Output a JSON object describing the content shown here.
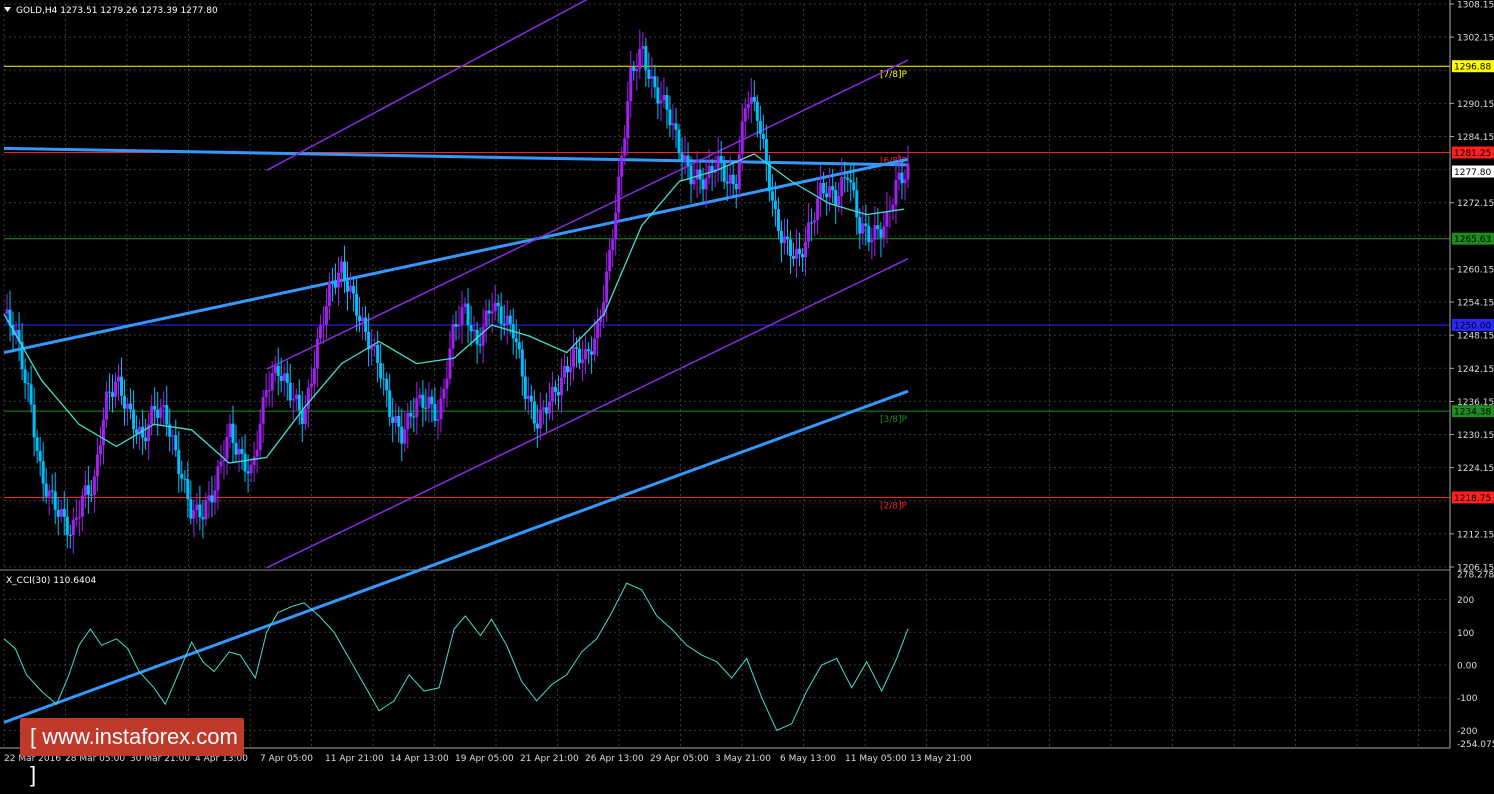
{
  "window": {
    "symbol_info": "GOLD,H4  1273.51 1279.26 1273.39 1277.80",
    "indicator_info": "X_CCI(30) 110.6404"
  },
  "price_axis": {
    "labels": [
      "1308.15",
      "1302.15",
      "1296.88",
      "1290.15",
      "1284.15",
      "1281.25",
      "1277.80",
      "1272.15",
      "1265.63",
      "1260.15",
      "1254.15",
      "1250.00",
      "1248.15",
      "1242.15",
      "1236.15",
      "1234.38",
      "1230.15",
      "1224.15",
      "1218.75",
      "1212.15",
      "1206.15"
    ]
  },
  "cci_axis": {
    "labels": [
      "278.278",
      "200",
      "100",
      "0.00",
      "-100",
      "-200",
      "-254.0753"
    ]
  },
  "time_axis": {
    "labels": [
      "22 Mar 2016",
      "28 Mar 05:00",
      "30 Mar 21:00",
      "4 Apr 13:00",
      "7 Apr 05:00",
      "11 Apr 21:00",
      "14 Apr 13:00",
      "19 Apr 05:00",
      "21 Apr 21:00",
      "26 Apr 13:00",
      "29 Apr 05:00",
      "3 May 21:00",
      "6 May 13:00",
      "11 May 05:00",
      "13 May 21:00"
    ]
  },
  "levels": [
    {
      "label": "[7/8]P",
      "price": 1296.88,
      "color": "#ffff00",
      "badge": "1296.88"
    },
    {
      "label": "[6/8]P",
      "price": 1281.25,
      "color": "#ff2020",
      "badge": "1281.25"
    },
    {
      "label": "",
      "price": 1265.63,
      "color": "#1e8c1e",
      "badge": "1265.63"
    },
    {
      "label": "",
      "price": 1250.0,
      "color": "#2828ff",
      "badge": "1250.00"
    },
    {
      "label": "[3/8]P",
      "price": 1234.38,
      "color": "#1e8c1e",
      "badge": "1234.38"
    },
    {
      "label": "[2/8]P",
      "price": 1218.75,
      "color": "#ff2020",
      "badge": "1218.75"
    }
  ],
  "current_price": "1277.80",
  "watermark": "www.instaforex.com",
  "colors": {
    "bull_candle": "#a020f0",
    "bear_candle": "#00bfff",
    "moving_average": "#40e0d0",
    "trend_line": "#3399ff",
    "channel_line": "#8a2be2",
    "cci_line": "#40e0d0",
    "grid": "#3a3a3a"
  },
  "chart_data": {
    "type": "candlestick",
    "symbol": "GOLD",
    "timeframe": "H4",
    "ohlc_last": {
      "open": 1273.51,
      "high": 1279.26,
      "low": 1273.39,
      "close": 1277.8
    },
    "close_path": [
      [
        0,
        1252
      ],
      [
        0.3,
        1249
      ],
      [
        0.7,
        1236
      ],
      [
        1,
        1222
      ],
      [
        1.4,
        1217
      ],
      [
        1.8,
        1212
      ],
      [
        2.1,
        1219
      ],
      [
        2.4,
        1221
      ],
      [
        2.7,
        1236
      ],
      [
        3,
        1240
      ],
      [
        3.4,
        1233
      ],
      [
        3.7,
        1229
      ],
      [
        4,
        1235
      ],
      [
        4.3,
        1234
      ],
      [
        4.6,
        1226
      ],
      [
        5,
        1216
      ],
      [
        5.3,
        1216
      ],
      [
        5.6,
        1220
      ],
      [
        6,
        1231
      ],
      [
        6.3,
        1226
      ],
      [
        6.6,
        1223
      ],
      [
        7,
        1239
      ],
      [
        7.3,
        1242
      ],
      [
        7.7,
        1237
      ],
      [
        8,
        1233
      ],
      [
        8.4,
        1248
      ],
      [
        8.7,
        1257
      ],
      [
        9,
        1260
      ],
      [
        9.3,
        1255
      ],
      [
        9.6,
        1249
      ],
      [
        10,
        1243
      ],
      [
        10.3,
        1234
      ],
      [
        10.6,
        1230
      ],
      [
        11,
        1236
      ],
      [
        11.3,
        1236
      ],
      [
        11.6,
        1233
      ],
      [
        12,
        1250
      ],
      [
        12.3,
        1253
      ],
      [
        12.6,
        1246
      ],
      [
        13,
        1254
      ],
      [
        13.3,
        1251
      ],
      [
        13.6,
        1249
      ],
      [
        13.9,
        1238
      ],
      [
        14.2,
        1232
      ],
      [
        14.5,
        1236
      ],
      [
        14.8,
        1239
      ],
      [
        15.2,
        1245
      ],
      [
        15.5,
        1244
      ],
      [
        15.8,
        1248
      ],
      [
        16.1,
        1260
      ],
      [
        16.4,
        1276
      ],
      [
        16.7,
        1295
      ],
      [
        17,
        1300
      ],
      [
        17.3,
        1293
      ],
      [
        17.7,
        1289
      ],
      [
        18,
        1282
      ],
      [
        18.3,
        1277
      ],
      [
        18.7,
        1276
      ],
      [
        19,
        1280
      ],
      [
        19.3,
        1276
      ],
      [
        19.5,
        1275
      ],
      [
        19.8,
        1292
      ],
      [
        20.1,
        1288
      ],
      [
        20.4,
        1276
      ],
      [
        20.6,
        1268
      ],
      [
        20.9,
        1264
      ],
      [
        21.2,
        1262
      ],
      [
        21.5,
        1268
      ],
      [
        21.8,
        1275
      ],
      [
        22.2,
        1273
      ],
      [
        22.5,
        1278
      ],
      [
        22.8,
        1268
      ],
      [
        23.1,
        1266
      ],
      [
        23.5,
        1268
      ],
      [
        23.8,
        1276
      ],
      [
        24.1,
        1277.8
      ]
    ],
    "moving_average": [
      [
        0,
        1252
      ],
      [
        1,
        1240
      ],
      [
        2,
        1232
      ],
      [
        3,
        1228
      ],
      [
        4,
        1232
      ],
      [
        5,
        1231
      ],
      [
        6,
        1225
      ],
      [
        7,
        1226
      ],
      [
        8,
        1235
      ],
      [
        9,
        1243
      ],
      [
        10,
        1247
      ],
      [
        11,
        1243
      ],
      [
        12,
        1244
      ],
      [
        13,
        1250
      ],
      [
        14,
        1248
      ],
      [
        15,
        1245
      ],
      [
        16,
        1252
      ],
      [
        17,
        1268
      ],
      [
        18,
        1276
      ],
      [
        19,
        1278
      ],
      [
        20,
        1281
      ],
      [
        21,
        1276
      ],
      [
        22,
        1272
      ],
      [
        23,
        1270
      ],
      [
        24,
        1271
      ]
    ],
    "cci": [
      [
        0,
        80
      ],
      [
        0.3,
        50
      ],
      [
        0.6,
        -30
      ],
      [
        1,
        -80
      ],
      [
        1.4,
        -120
      ],
      [
        1.7,
        -40
      ],
      [
        2,
        60
      ],
      [
        2.3,
        110
      ],
      [
        2.6,
        60
      ],
      [
        3,
        80
      ],
      [
        3.3,
        50
      ],
      [
        3.6,
        -20
      ],
      [
        4,
        -70
      ],
      [
        4.3,
        -120
      ],
      [
        4.6,
        -40
      ],
      [
        5,
        70
      ],
      [
        5.3,
        10
      ],
      [
        5.6,
        -20
      ],
      [
        6,
        40
      ],
      [
        6.3,
        30
      ],
      [
        6.7,
        -40
      ],
      [
        7,
        100
      ],
      [
        7.3,
        160
      ],
      [
        7.7,
        180
      ],
      [
        8,
        190
      ],
      [
        8.4,
        150
      ],
      [
        8.8,
        100
      ],
      [
        9.2,
        20
      ],
      [
        9.6,
        -60
      ],
      [
        10,
        -140
      ],
      [
        10.4,
        -110
      ],
      [
        10.8,
        -30
      ],
      [
        11.2,
        -80
      ],
      [
        11.6,
        -70
      ],
      [
        12,
        110
      ],
      [
        12.3,
        150
      ],
      [
        12.7,
        90
      ],
      [
        13,
        140
      ],
      [
        13.4,
        60
      ],
      [
        13.8,
        -50
      ],
      [
        14.2,
        -110
      ],
      [
        14.6,
        -60
      ],
      [
        15,
        -30
      ],
      [
        15.4,
        40
      ],
      [
        15.8,
        80
      ],
      [
        16.2,
        160
      ],
      [
        16.6,
        250
      ],
      [
        17,
        230
      ],
      [
        17.4,
        150
      ],
      [
        17.8,
        110
      ],
      [
        18.2,
        60
      ],
      [
        18.6,
        30
      ],
      [
        19,
        10
      ],
      [
        19.4,
        -40
      ],
      [
        19.8,
        20
      ],
      [
        20.2,
        -100
      ],
      [
        20.6,
        -200
      ],
      [
        21,
        -180
      ],
      [
        21.4,
        -80
      ],
      [
        21.8,
        0
      ],
      [
        22.2,
        20
      ],
      [
        22.6,
        -70
      ],
      [
        23,
        10
      ],
      [
        23.4,
        -80
      ],
      [
        23.8,
        20
      ],
      [
        24.1,
        110.64
      ]
    ],
    "trend_lines": [
      [
        [
          0,
          1282
        ],
        [
          24.1,
          1279
        ]
      ],
      [
        [
          0,
          1245
        ],
        [
          24.1,
          1280
        ]
      ],
      [
        [
          0,
          1178
        ],
        [
          24.1,
          1238
        ]
      ]
    ],
    "channel_lines": [
      [
        [
          7,
          1278
        ],
        [
          24.1,
          1340
        ]
      ],
      [
        [
          7,
          1242
        ],
        [
          24.1,
          1298
        ]
      ],
      [
        [
          7,
          1206
        ],
        [
          24.1,
          1262
        ]
      ]
    ],
    "price_ylim": [
      1206.15,
      1308.15
    ],
    "cci_ylim": [
      -254.0753,
      278.278
    ],
    "cci_levels": [
      200,
      100,
      0,
      -100,
      -200
    ],
    "x_range": [
      0,
      24.1
    ],
    "grid": true
  }
}
